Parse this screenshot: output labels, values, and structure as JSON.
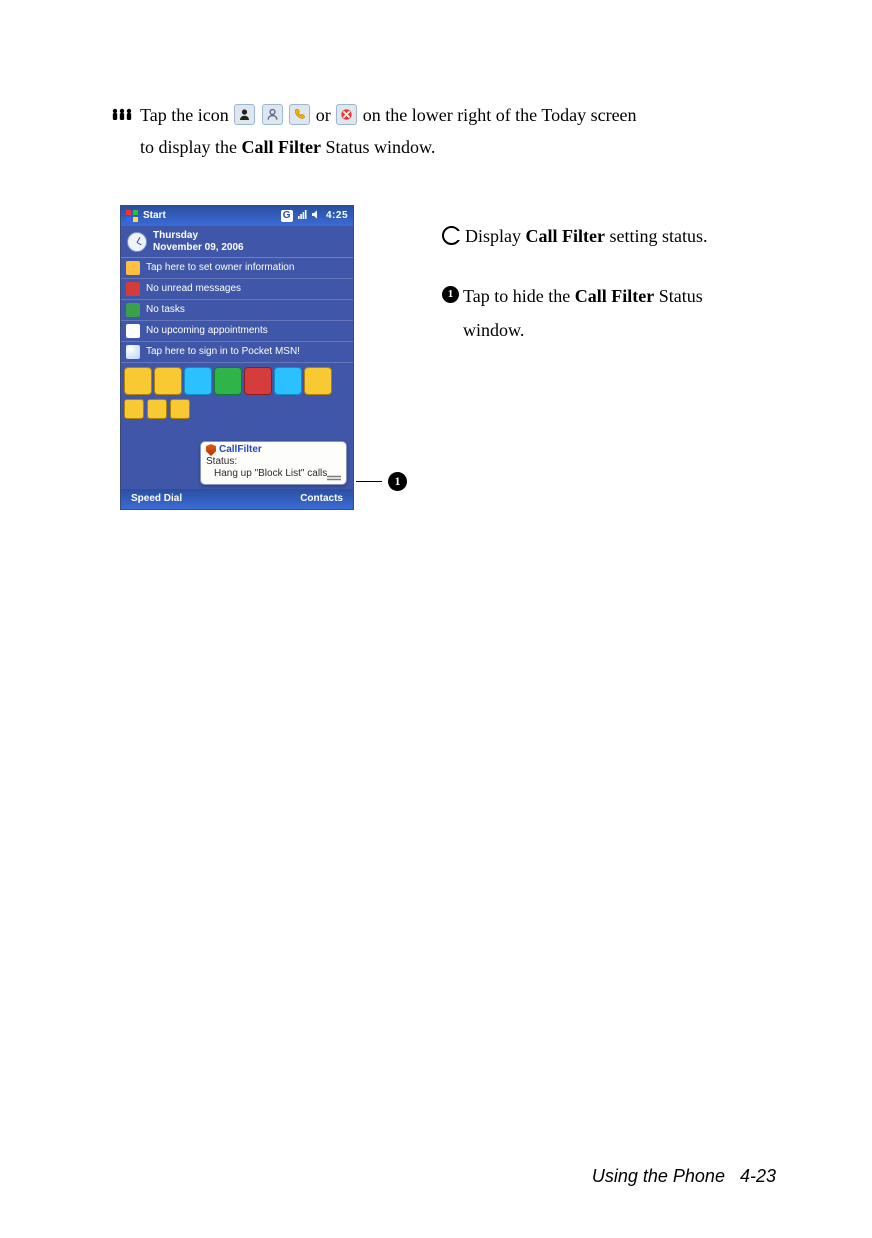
{
  "instruction": {
    "bullet_glyph": "♟♟♟",
    "text_before_icons": "Tap the icon",
    "or": "or",
    "text_after_icons": "on the lower right of the Today screen",
    "line2_prefix": "to display the ",
    "line2_bold": "Call Filter",
    "line2_suffix": " Status window."
  },
  "screenshot": {
    "title": "Start",
    "status_time": "4:25",
    "date_day": "Thursday",
    "date_full": "November 09, 2006",
    "rows": [
      "Tap here to set owner information",
      "No unread messages",
      "No tasks",
      "No upcoming appointments",
      "Tap here to sign in to Pocket MSN!"
    ],
    "popup": {
      "title": "CallFilter",
      "status_label": "Status:",
      "body": "Hang up \"Block List\" calls"
    },
    "softkey_left": "Speed Dial",
    "softkey_right": "Contacts"
  },
  "callout_label": "1",
  "notes": {
    "c": {
      "prefix": "Display ",
      "bold": "Call Filter",
      "suffix": " setting status."
    },
    "one": {
      "prefix": "Tap to hide the ",
      "bold": "Call Filter",
      "suffix": " Status",
      "line2": "window."
    }
  },
  "footer": {
    "section": "Using the Phone",
    "page": "4-23"
  }
}
